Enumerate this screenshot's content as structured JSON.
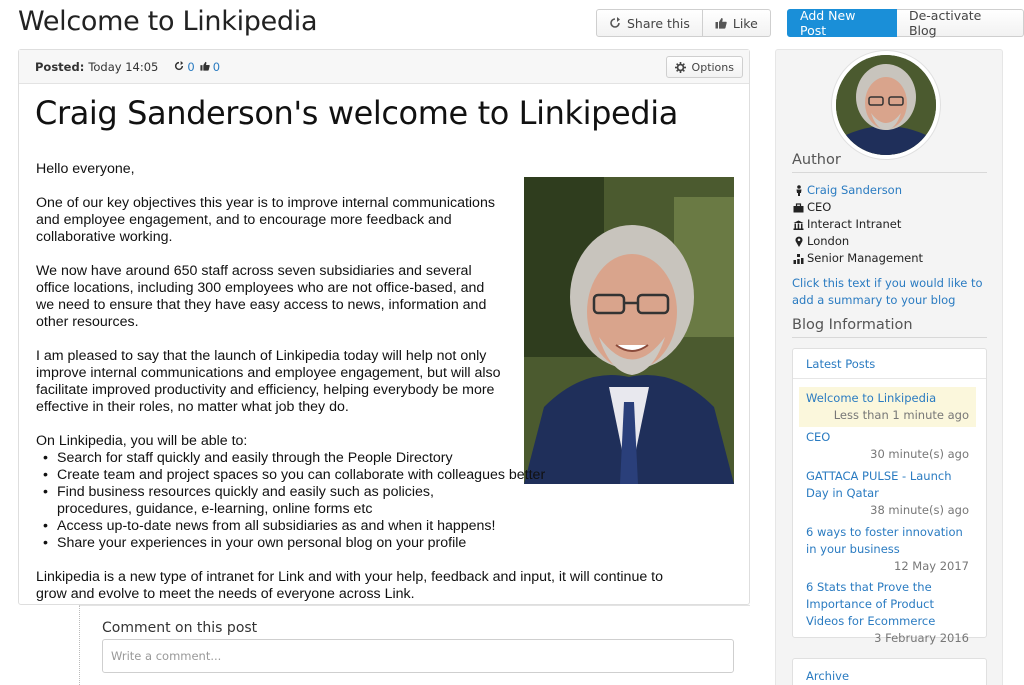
{
  "header": {
    "title": "Welcome to Linkipedia",
    "share_label": "Share this",
    "like_label": "Like",
    "add_post_label": "Add New Post",
    "deactivate_label": "De-activate Blog"
  },
  "post": {
    "posted_label": "Posted:",
    "posted_time": "Today 14:05",
    "share_count": "0",
    "like_count": "0",
    "options_label": "Options",
    "heading": "Craig Sanderson's welcome to Linkipedia",
    "greeting": "Hello everyone,",
    "para1": "One of our key objectives this year is to improve internal communications and employee engagement, and to encourage more feedback and collaborative working.",
    "para2": "We now have around 650 staff across seven subsidiaries and several office locations, including 300 employees who are not office-based, and we need to ensure that they have easy access to news, information and other resources.",
    "para3": "I am pleased to say that the launch of Linkipedia today will help not only improve internal communications and employee engagement, but will also facilitate improved productivity and efficiency, helping everybody be more effective in their roles, no matter what job they do.",
    "list_intro": "On Linkipedia, you will be able to:",
    "list_items": [
      "Search for staff quickly and easily through the People Directory",
      "Create team and project spaces so you can collaborate with colleagues better",
      "Find business resources quickly and easily such as policies, procedures, guidance, e-learning, online forms etc",
      "Access up-to-date news from all subsidiaries as and when it happens!",
      "Share your experiences in your own personal blog on your profile"
    ],
    "closing": "Linkipedia is a new type of intranet for Link and with your help, feedback and input, it will continue to grow and evolve to meet the needs of everyone across Link."
  },
  "comments": {
    "label": "Comment on this post",
    "placeholder": "Write a comment..."
  },
  "sidebar": {
    "author_heading": "Author",
    "author_name": "Craig Sanderson",
    "author_role": "CEO",
    "author_company": "Interact Intranet",
    "author_location": "London",
    "author_department": "Senior Management",
    "summary_prompt": "Click this text if you would like to add a summary to your blog",
    "blog_info_heading": "Blog Information",
    "latest_posts_title": "Latest Posts",
    "latest_posts": [
      {
        "title": "Welcome to Linkipedia",
        "time": "Less than 1 minute ago"
      },
      {
        "title": "CEO",
        "time": "30 minute(s) ago"
      },
      {
        "title": "GATTACA PULSE - Launch Day in Qatar",
        "time": "38 minute(s) ago"
      },
      {
        "title": "6 ways to foster innovation in your business",
        "time": "12 May 2017"
      },
      {
        "title": "6 Stats that Prove the Importance of Product Videos for Ecommerce",
        "time": "3 February 2016"
      }
    ],
    "archive_title": "Archive"
  },
  "icons": {
    "share": "share-icon",
    "like": "thumbs-up-icon",
    "options": "gear-icon",
    "person": "person-icon",
    "role": "briefcase-icon",
    "company": "building-icon",
    "location": "map-pin-icon",
    "department": "org-chart-icon"
  },
  "colors": {
    "accent": "#1a8fd8",
    "link": "#2a7bc1",
    "active_post_bg": "#fbf7dc"
  }
}
